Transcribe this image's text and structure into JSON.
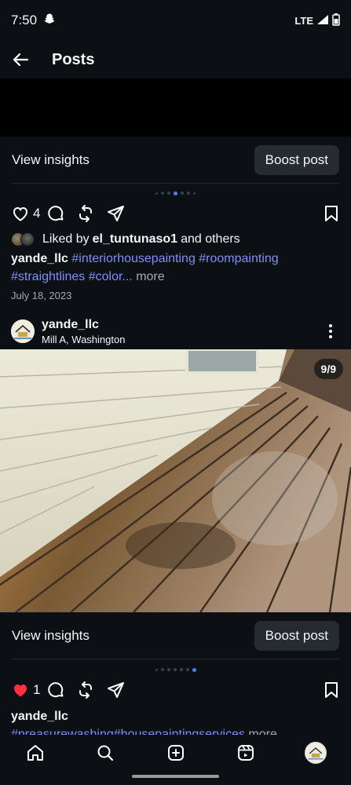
{
  "status_bar": {
    "time": "7:50",
    "network": "LTE"
  },
  "header": {
    "title": "Posts"
  },
  "post1": {
    "view_insights": "View insights",
    "boost_post": "Boost post",
    "like_count": "4",
    "liked_prefix": "Liked by",
    "liked_user": "el_tuntunaso1",
    "liked_suffix": "and others",
    "caption_user": "yande_llc",
    "caption_tags_line1": "#interiorhousepainting #roompainting",
    "caption_tags_line2": "#straightlines #color...",
    "more": "more",
    "date": "July 18, 2023"
  },
  "post2": {
    "username": "yande_llc",
    "location": "Mill A, Washington",
    "image_counter": "9/9",
    "view_insights": "View insights",
    "boost_post": "Boost post",
    "like_count": "1",
    "caption_user": "yande_llc",
    "caption_tags": "#preasurewashing#housepaintingservices",
    "more": "more"
  },
  "bottom_nav": [
    "home-icon",
    "search-icon",
    "create-icon",
    "reels-icon",
    "profile-avatar"
  ],
  "colors": {
    "background": "#0c1014",
    "button": "#262a31",
    "hashtag": "#7e8ef6",
    "like_red": "#ff3040",
    "dot_active": "#4f7cff"
  }
}
